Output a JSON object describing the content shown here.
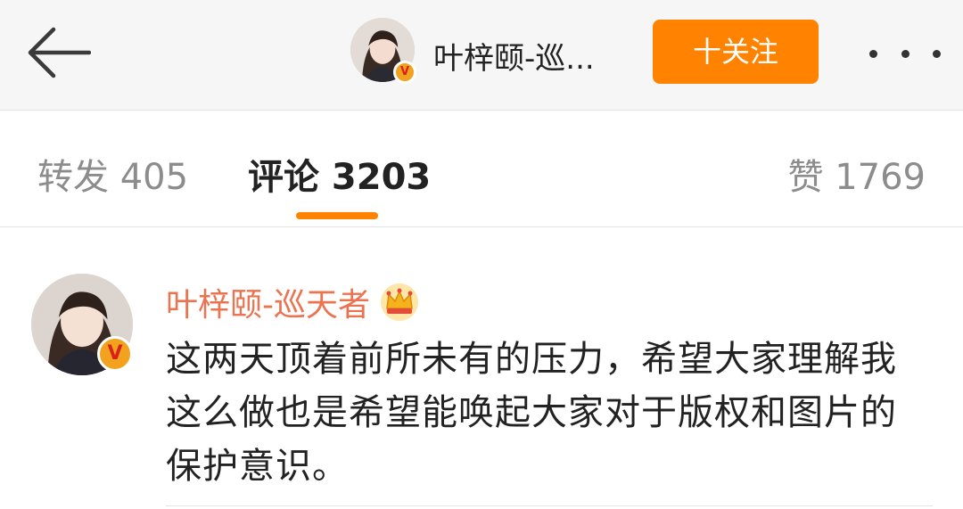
{
  "header": {
    "back_icon": "back-arrow-icon",
    "author_name_truncated": "叶梓颐-巡...",
    "verified_badge": "V",
    "follow_label": "十关注",
    "more_icon": "more-dots-icon"
  },
  "tabs": {
    "repost": "转发 405",
    "comments": "评论 3203",
    "likes": "赞 1769"
  },
  "comment": {
    "author": "叶梓颐-巡天者",
    "verified_badge": "V",
    "crown_icon": "crown-icon",
    "text": "这两天顶着前所未有的压力，希望大家理解我这么做也是希望能唤起大家对于版权和图片的保护意识。"
  },
  "colors": {
    "accent": "#ff8200",
    "username": "#eb7350",
    "badge": "#f2a21e"
  }
}
